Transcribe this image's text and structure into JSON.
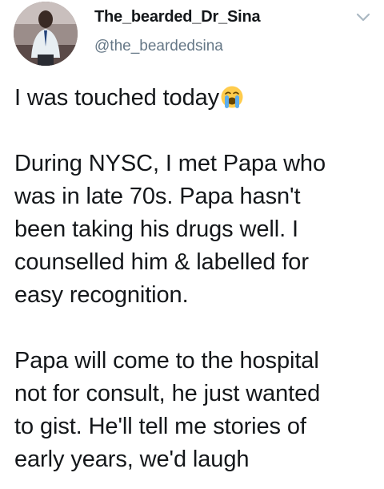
{
  "author": {
    "display_name": "The_bearded_Dr_Sina",
    "handle": "@the_beardedsina",
    "avatar_icon": "profile-photo"
  },
  "menu": {
    "icon": "chevron-down-icon",
    "color": "#aab8c2"
  },
  "tweet": {
    "line1": "I was touched today",
    "line1_emoji": "loudly-crying-face-emoji",
    "paragraph1": [
      "During NYSC, I met Papa who",
      "was in late 70s. Papa hasn't",
      "been taking his drugs well. I",
      "counselled him & labelled for",
      "easy recognition."
    ],
    "paragraph2": [
      "Papa will come to the hospital",
      "not for consult, he just wanted",
      "to gist. He'll tell me stories of",
      "early years, we'd laugh"
    ]
  },
  "colors": {
    "text": "#14171a",
    "secondary": "#657786",
    "emoji_face": "#ffcc4d",
    "emoji_tears": "#5dadec"
  }
}
